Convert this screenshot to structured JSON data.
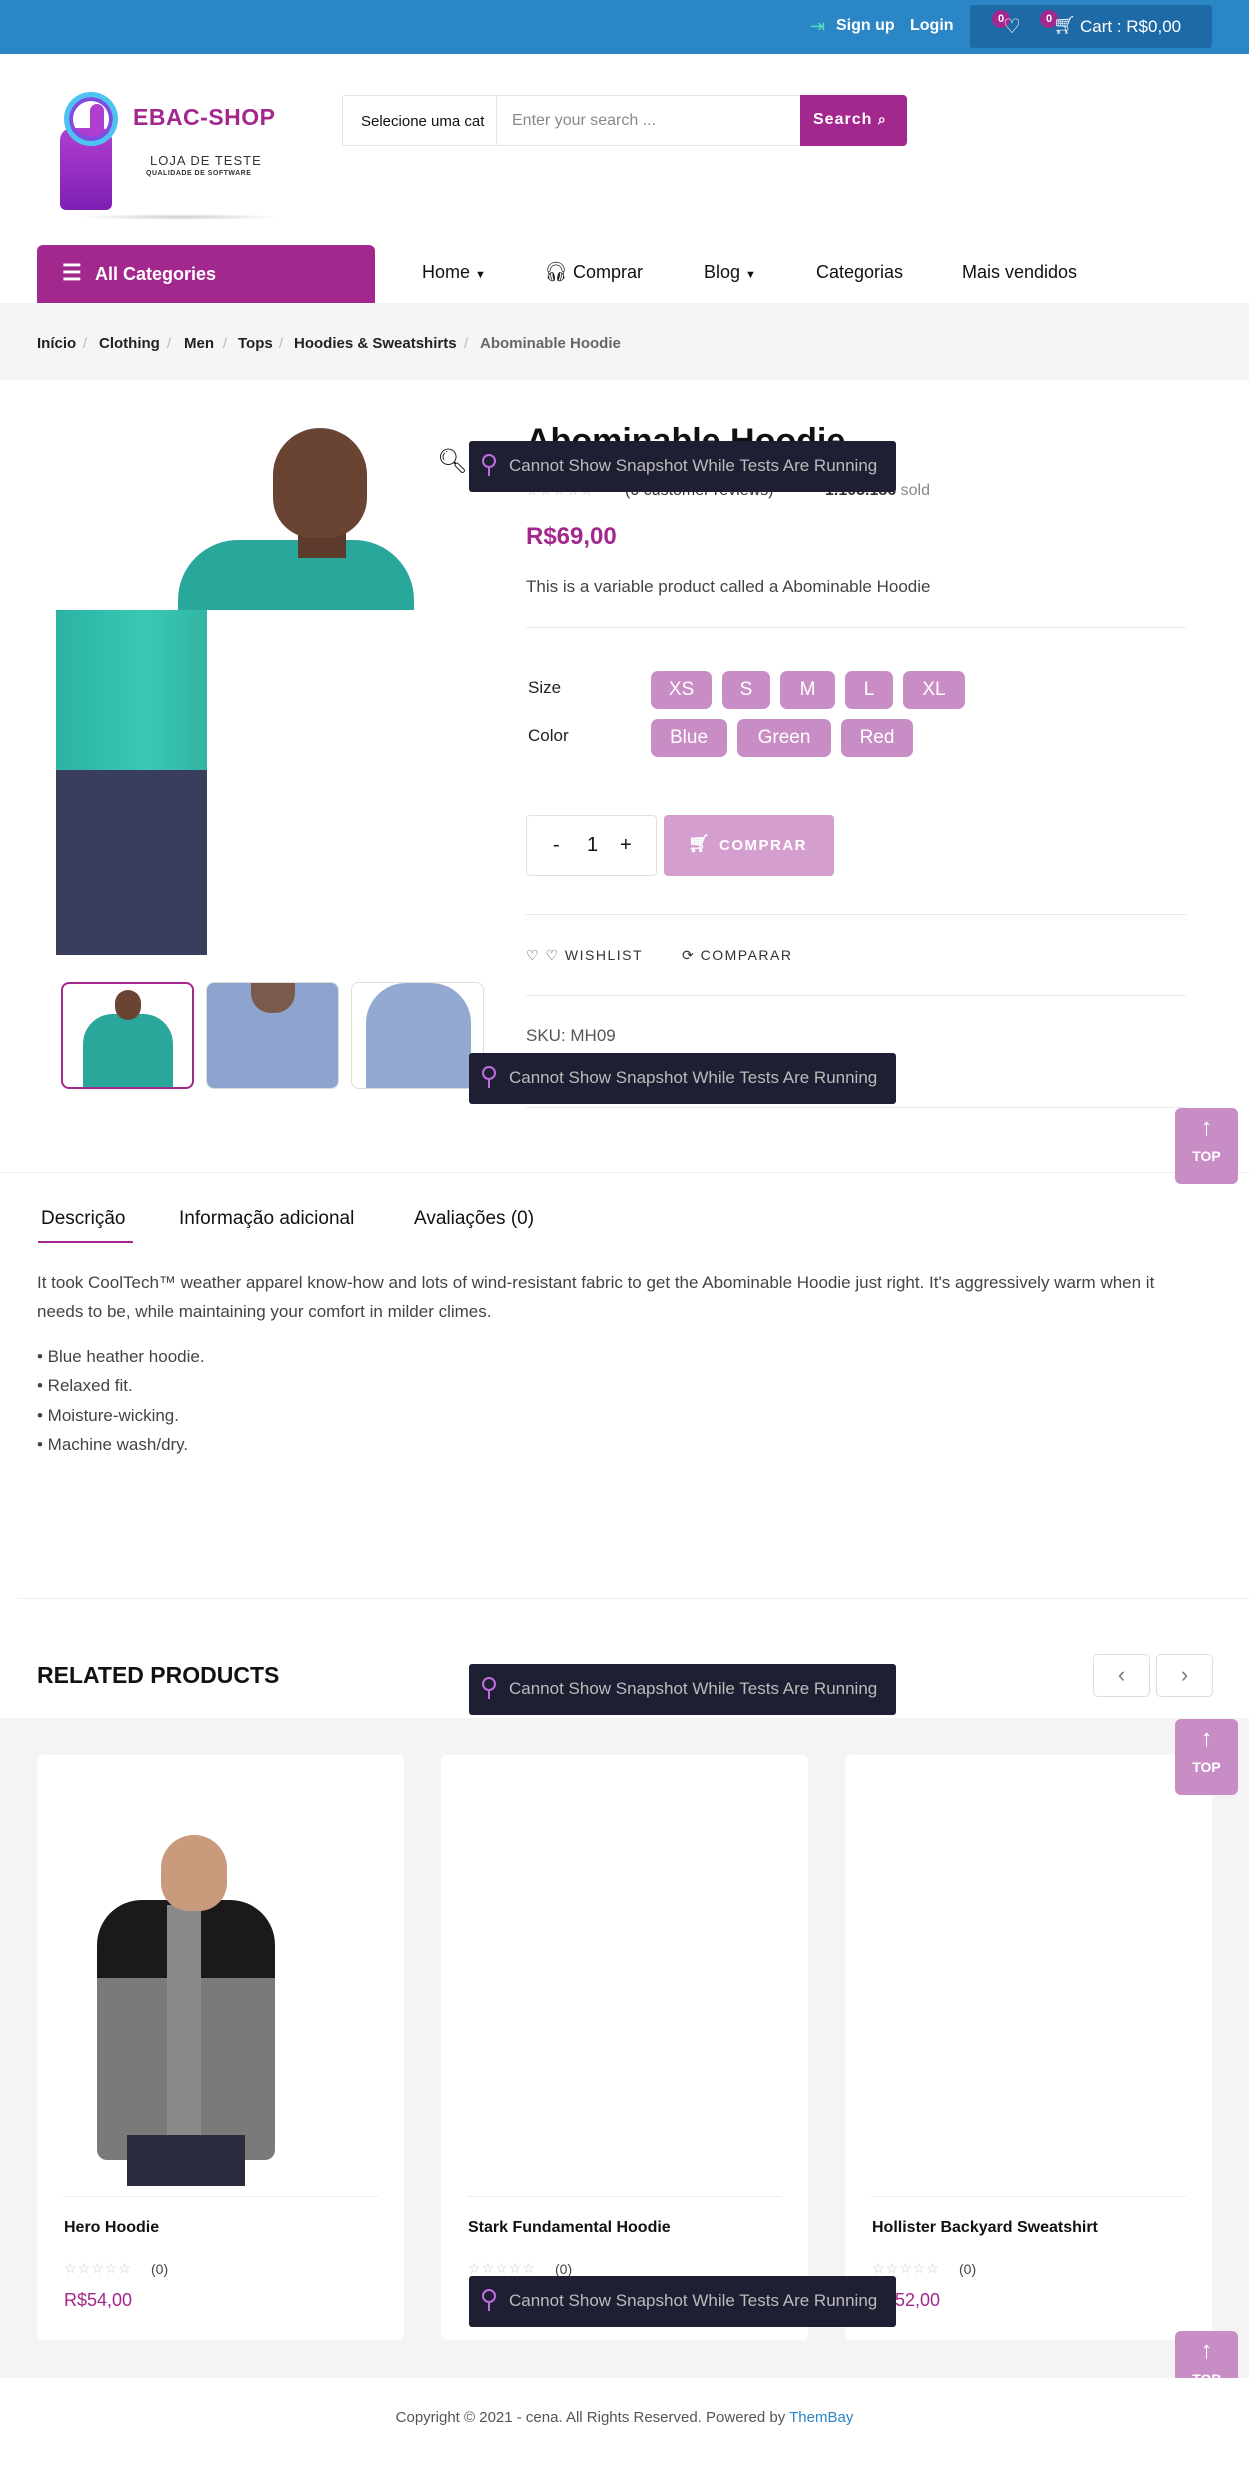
{
  "topbar": {
    "signup": "Sign up",
    "login": "Login",
    "wishlist_count": "0",
    "cart_count": "0",
    "cart_label": "Cart : R$0,00"
  },
  "header": {
    "logo_title": "EBAC-SHOP",
    "logo_sub1": "LOJA DE TESTE",
    "logo_sub2": "QUALIDADE DE SOFTWARE",
    "search_category": "Selecione uma cat",
    "search_placeholder": "Enter your search ...",
    "search_button": "Search"
  },
  "nav": {
    "all_categories": "All Categories",
    "items": [
      "Home",
      "Comprar",
      "Blog",
      "Categorias",
      "Mais vendidos"
    ]
  },
  "breadcrumb": [
    "Início",
    "Clothing",
    "Men",
    "Tops",
    "Hoodies & Sweatshirts",
    "Abominable Hoodie"
  ],
  "product": {
    "title": "Abominable Hoodie",
    "reviews": "(0 customer reviews)",
    "sold_count": "1.105.186",
    "sold_label": "sold",
    "price": "R$69,00",
    "short_desc": "This is a variable product called a Abominable Hoodie",
    "size_label": "Size",
    "sizes": [
      "XS",
      "S",
      "M",
      "L",
      "XL"
    ],
    "color_label": "Color",
    "colors": [
      "Blue",
      "Green",
      "Red"
    ],
    "qty_minus": "-",
    "qty_value": "1",
    "qty_plus": "+",
    "buy_button": "COMPRAR",
    "wishlist": "WISHLIST",
    "compare": "COMPARAR",
    "sku": "SKU: MH09"
  },
  "toast": "Cannot Show Snapshot While Tests Are Running",
  "top_button": "TOP",
  "tabs": [
    "Descrição",
    "Informação adicional",
    "Avaliações (0)"
  ],
  "description": {
    "paragraph": "It took CoolTech™ weather apparel know-how and lots of wind-resistant fabric to get the Abominable Hoodie just right. It's aggressively warm when it needs to be, while maintaining your comfort in milder climes.",
    "bullets": [
      "• Blue heather hoodie.",
      "• Relaxed fit.",
      "• Moisture-wicking.",
      "• Machine wash/dry."
    ]
  },
  "related": {
    "title": "RELATED PRODUCTS",
    "products": [
      {
        "name": "Hero Hoodie",
        "count": "(0)",
        "price": "R$54,00"
      },
      {
        "name": "Stark Fundamental Hoodie",
        "count": "(0)",
        "price": ""
      },
      {
        "name": "Hollister Backyard Sweatshirt",
        "count": "(0)",
        "price": "R$52,00"
      }
    ]
  },
  "footer": {
    "copyright": "Copyright © 2021 - cena. All Rights Reserved. Powered by",
    "powered_by": "ThemBay"
  },
  "colors": {
    "accent": "#a3288d",
    "topbar": "#2b86c5",
    "swatch": "#c98dc5"
  }
}
